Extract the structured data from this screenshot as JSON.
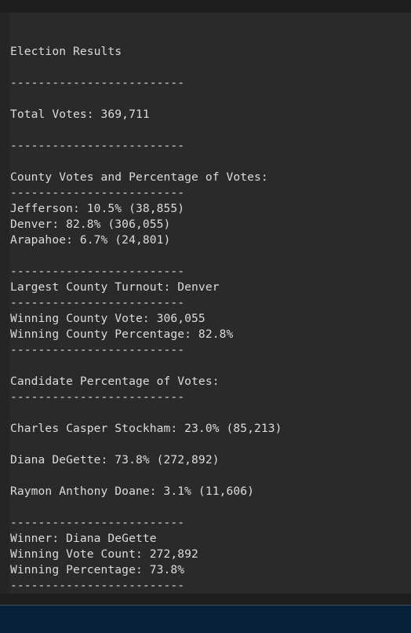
{
  "terminal": {
    "lines": [
      "",
      "Election Results",
      "",
      "-------------------------",
      "",
      "Total Votes: 369,711",
      "",
      "-------------------------",
      "",
      "County Votes and Percentage of Votes:",
      "-------------------------",
      "Jefferson: 10.5% (38,855)",
      "Denver: 82.8% (306,055)",
      "Arapahoe: 6.7% (24,801)",
      "",
      "-------------------------",
      "Largest County Turnout: Denver",
      "-------------------------",
      "Winning County Vote: 306,055",
      "Winning County Percentage: 82.8%",
      "-------------------------",
      "",
      "Candidate Percentage of Votes:",
      "-------------------------",
      "",
      "Charles Casper Stockham: 23.0% (85,213)",
      "",
      "Diana DeGette: 73.8% (272,892)",
      "",
      "Raymon Anthony Doane: 3.1% (11,606)",
      "",
      "-------------------------",
      "Winner: Diana DeGette",
      "Winning Vote Count: 272,892",
      "Winning Percentage: 73.8%",
      "-------------------------"
    ]
  }
}
